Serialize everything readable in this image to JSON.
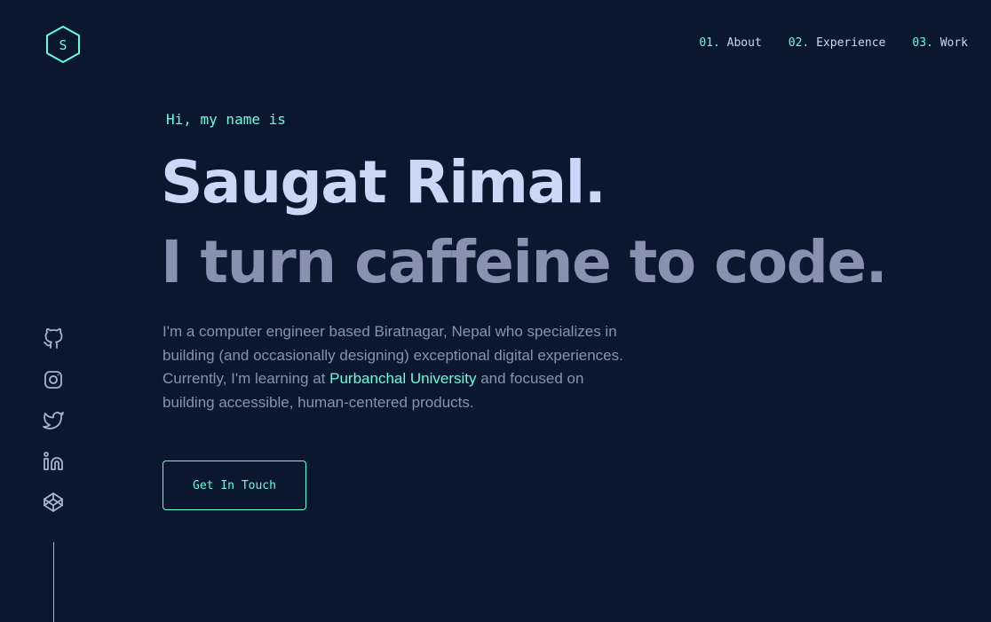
{
  "logo": {
    "letter": "S",
    "color": "#64ffda"
  },
  "nav": {
    "items": [
      {
        "num": "01.",
        "label": "About"
      },
      {
        "num": "02.",
        "label": "Experience"
      },
      {
        "num": "03.",
        "label": "Work"
      }
    ]
  },
  "hero": {
    "intro": "Hi, my name is",
    "name": "Saugat Rimal.",
    "tagline": "I turn caffeine to code.",
    "desc_before": "I'm a computer engineer based Biratnagar, Nepal who specializes in building (and occasionally designing) exceptional digital experiences. Currently, I'm learning at ",
    "desc_link": "Purbanchal University",
    "desc_after": " and focused on building accessible, human-centered products.",
    "cta_label": "Get In Touch"
  },
  "social": [
    "github-icon",
    "instagram-icon",
    "twitter-icon",
    "linkedin-icon",
    "codepen-icon"
  ],
  "colors": {
    "background": "#0b172e",
    "accent": "#64ffda",
    "heading": "#ccd6f6",
    "text": "#8892b0"
  }
}
